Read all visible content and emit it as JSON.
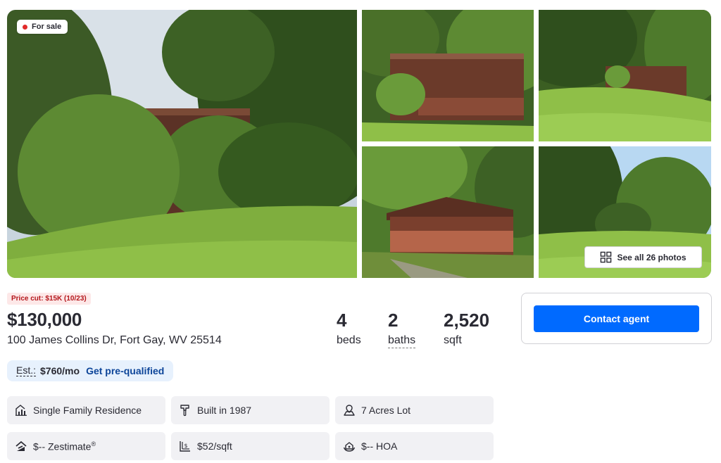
{
  "gallery": {
    "status_badge": "For sale",
    "see_all_label": "See all 26 photos"
  },
  "listing": {
    "price_cut": "Price cut: $15K (10/23)",
    "price": "$130,000",
    "address": "100 James Collins Dr, Fort Gay, WV 25514"
  },
  "facts": {
    "beds": {
      "value": "4",
      "label": "beds"
    },
    "baths": {
      "value": "2",
      "label": "baths"
    },
    "sqft": {
      "value": "2,520",
      "label": "sqft"
    }
  },
  "estimate": {
    "label": "Est.:",
    "value": "$760/mo",
    "link": "Get pre-qualified"
  },
  "details": [
    {
      "icon": "house-chart-icon",
      "text": "Single Family Residence"
    },
    {
      "icon": "hammer-icon",
      "text": "Built in 1987"
    },
    {
      "icon": "lot-icon",
      "text": "7 Acres Lot"
    },
    {
      "icon": "zestimate-icon",
      "text": "$-- Zestimate",
      "sup": "®"
    },
    {
      "icon": "price-per-sqft-icon",
      "text": "$52/sqft"
    },
    {
      "icon": "hoa-icon",
      "text": "$-- HOA"
    }
  ],
  "contact": {
    "button_label": "Contact agent"
  },
  "colors": {
    "accent": "#006aff",
    "price_cut_bg": "#fde8e8",
    "price_cut_text": "#b4161b",
    "estimate_bg": "#e7f1fd",
    "link": "#0d4599",
    "tile_bg": "#f1f1f4"
  }
}
